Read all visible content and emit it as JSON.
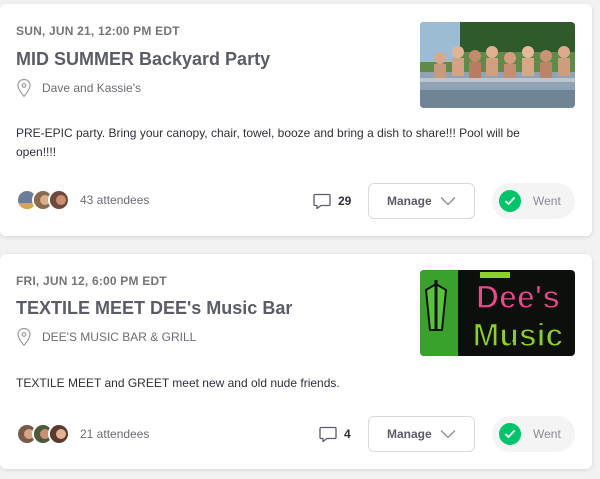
{
  "colors": {
    "went_green": "#00c46a",
    "title_gray": "#5a5c66",
    "card_bg": "#ffffff",
    "page_bg": "#f2f2f2"
  },
  "events": [
    {
      "date": "SUN, JUN 21, 12:00 PM EDT",
      "title": "MID SUMMER Backyard Party",
      "venue": "Dave and Kassie's",
      "description": "PRE-EPIC party. Bring your canopy, chair, towel, booze and bring a dish to share!!! Pool will be open!!!!",
      "attendees": "43 attendees",
      "comments": "29",
      "manage_label": "Manage",
      "went_label": "Went"
    },
    {
      "date": "FRI, JUN 12, 6:00 PM EDT",
      "title": "TEXTILE MEET DEE's Music Bar",
      "venue": "DEE'S MUSIC BAR & GRILL",
      "description": "TEXTILE MEET and GREET meet new and old nude friends.",
      "attendees": "21 attendees",
      "comments": "4",
      "manage_label": "Manage",
      "went_label": "Went",
      "image_text": {
        "line1": "Dee's",
        "line2": "Music"
      }
    }
  ],
  "icons": [
    "location-pin-icon",
    "comment-icon",
    "chevron-down-icon",
    "checkmark-icon"
  ]
}
